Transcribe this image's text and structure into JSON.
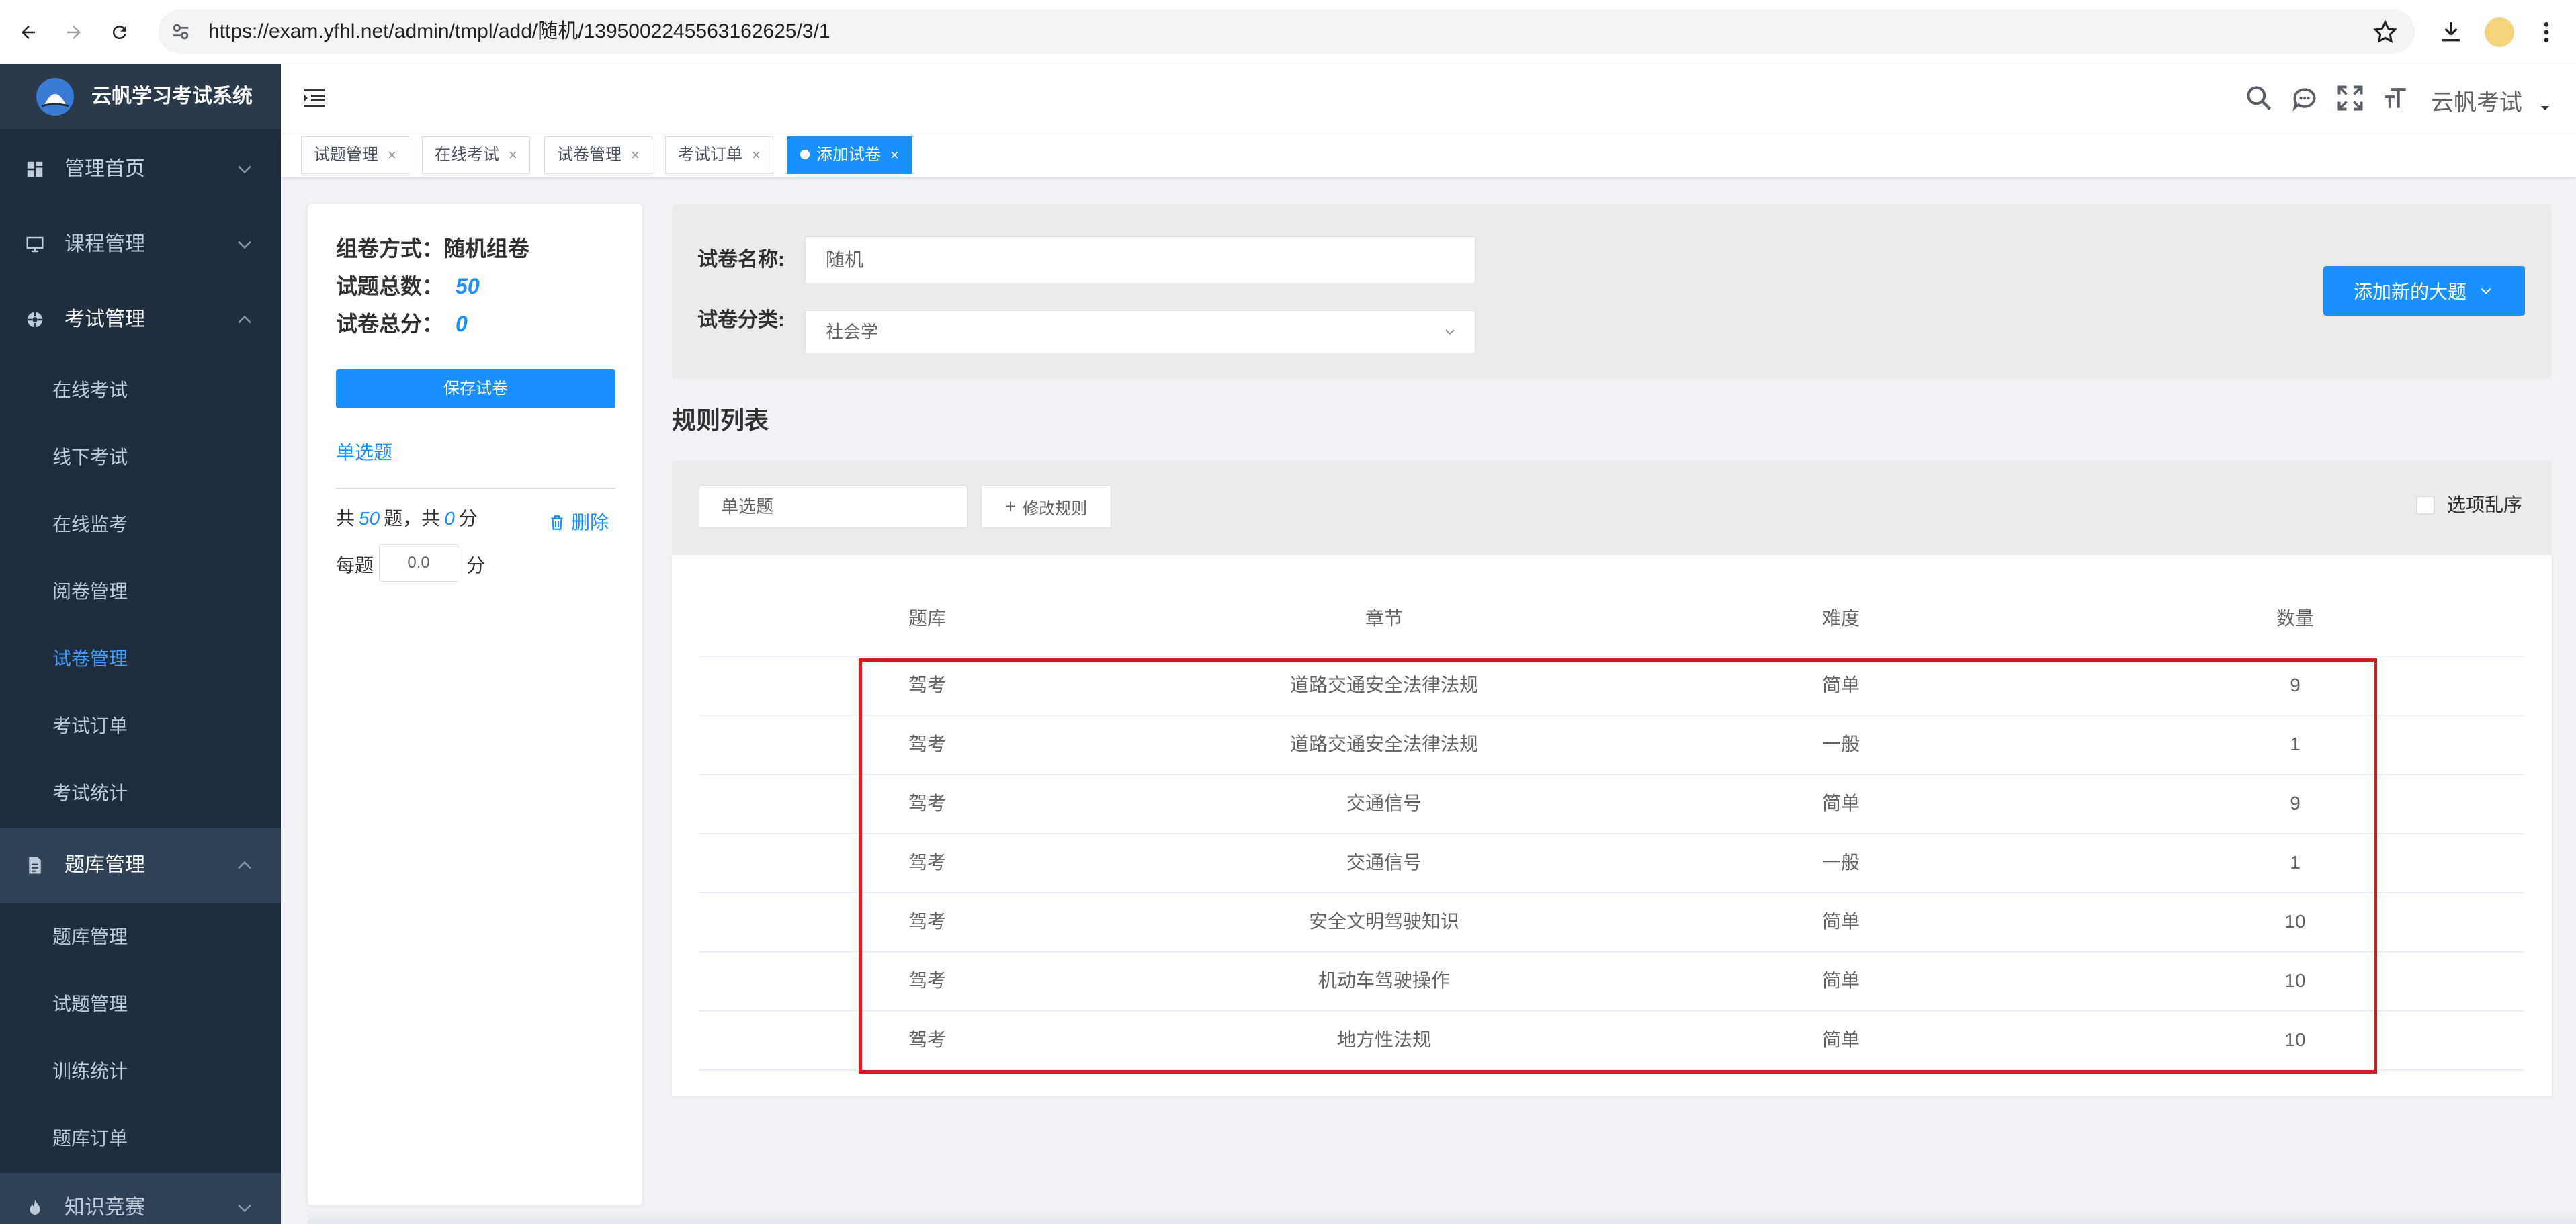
{
  "browser": {
    "url": "https://exam.yfhl.net/admin/tmpl/add/随机/1395002245563162625/3/1"
  },
  "app": {
    "title": "云帆学习考试系统",
    "user": "云帆考试"
  },
  "sidebar": {
    "groups": [
      {
        "label": "管理首页",
        "icon": "dashboard-icon"
      },
      {
        "label": "课程管理",
        "icon": "monitor-icon"
      },
      {
        "label": "考试管理",
        "icon": "exam-icon",
        "items": [
          "在线考试",
          "线下考试",
          "在线监考",
          "阅卷管理",
          "试卷管理",
          "考试订单",
          "考试统计"
        ],
        "active": "试卷管理"
      },
      {
        "label": "题库管理",
        "icon": "document-icon",
        "items": [
          "题库管理",
          "试题管理",
          "训练统计",
          "题库订单"
        ]
      },
      {
        "label": "知识竞赛",
        "icon": "fire-icon"
      }
    ]
  },
  "tabs": [
    {
      "label": "试题管理"
    },
    {
      "label": "在线考试"
    },
    {
      "label": "试卷管理"
    },
    {
      "label": "考试订单"
    },
    {
      "label": "添加试卷",
      "active": true
    }
  ],
  "summary": {
    "mode_label": "组卷方式：",
    "mode_value": "随机组卷",
    "total_q_label": "试题总数：",
    "total_q_value": "50",
    "total_score_label": "试卷总分：",
    "total_score_value": "0",
    "save_label": "保存试卷",
    "type_title": "单选题",
    "count_prefix": "共",
    "count_value": "50",
    "count_mid": "题，共",
    "score_value": "0",
    "score_suffix": "分",
    "delete_label": "删除",
    "per_label": "每题",
    "per_value": "0.0",
    "per_unit": "分"
  },
  "form": {
    "name_label": "试卷名称:",
    "name_value": "随机",
    "category_label": "试卷分类:",
    "category_value": "社会学",
    "add_button": "添加新的大题"
  },
  "rules": {
    "title": "规则列表",
    "type_value": "单选题",
    "edit_button": "修改规则",
    "shuffle_label": "选项乱序",
    "columns": [
      "题库",
      "章节",
      "难度",
      "数量"
    ],
    "rows": [
      [
        "驾考",
        "道路交通安全法律法规",
        "简单",
        "9"
      ],
      [
        "驾考",
        "道路交通安全法律法规",
        "一般",
        "1"
      ],
      [
        "驾考",
        "交通信号",
        "简单",
        "9"
      ],
      [
        "驾考",
        "交通信号",
        "一般",
        "1"
      ],
      [
        "驾考",
        "安全文明驾驶知识",
        "简单",
        "10"
      ],
      [
        "驾考",
        "机动车驾驶操作",
        "简单",
        "10"
      ],
      [
        "驾考",
        "地方性法规",
        "简单",
        "10"
      ]
    ]
  },
  "colors": {
    "primary": "#1890ff",
    "sidebar_bg": "#1f2d3d",
    "highlight": "#cc1f1f"
  }
}
